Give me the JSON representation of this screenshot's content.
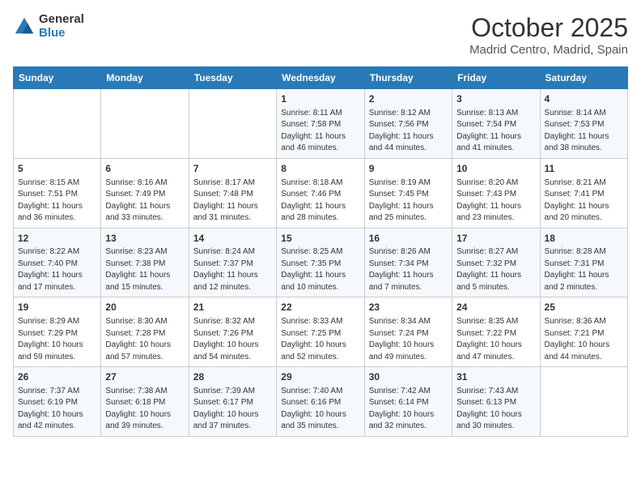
{
  "logo": {
    "line1": "General",
    "line2": "Blue"
  },
  "header": {
    "month": "October 2025",
    "location": "Madrid Centro, Madrid, Spain"
  },
  "days_of_week": [
    "Sunday",
    "Monday",
    "Tuesday",
    "Wednesday",
    "Thursday",
    "Friday",
    "Saturday"
  ],
  "weeks": [
    [
      {
        "day": "",
        "content": ""
      },
      {
        "day": "",
        "content": ""
      },
      {
        "day": "",
        "content": ""
      },
      {
        "day": "1",
        "content": "Sunrise: 8:11 AM\nSunset: 7:58 PM\nDaylight: 11 hours and 46 minutes."
      },
      {
        "day": "2",
        "content": "Sunrise: 8:12 AM\nSunset: 7:56 PM\nDaylight: 11 hours and 44 minutes."
      },
      {
        "day": "3",
        "content": "Sunrise: 8:13 AM\nSunset: 7:54 PM\nDaylight: 11 hours and 41 minutes."
      },
      {
        "day": "4",
        "content": "Sunrise: 8:14 AM\nSunset: 7:53 PM\nDaylight: 11 hours and 38 minutes."
      }
    ],
    [
      {
        "day": "5",
        "content": "Sunrise: 8:15 AM\nSunset: 7:51 PM\nDaylight: 11 hours and 36 minutes."
      },
      {
        "day": "6",
        "content": "Sunrise: 8:16 AM\nSunset: 7:49 PM\nDaylight: 11 hours and 33 minutes."
      },
      {
        "day": "7",
        "content": "Sunrise: 8:17 AM\nSunset: 7:48 PM\nDaylight: 11 hours and 31 minutes."
      },
      {
        "day": "8",
        "content": "Sunrise: 8:18 AM\nSunset: 7:46 PM\nDaylight: 11 hours and 28 minutes."
      },
      {
        "day": "9",
        "content": "Sunrise: 8:19 AM\nSunset: 7:45 PM\nDaylight: 11 hours and 25 minutes."
      },
      {
        "day": "10",
        "content": "Sunrise: 8:20 AM\nSunset: 7:43 PM\nDaylight: 11 hours and 23 minutes."
      },
      {
        "day": "11",
        "content": "Sunrise: 8:21 AM\nSunset: 7:41 PM\nDaylight: 11 hours and 20 minutes."
      }
    ],
    [
      {
        "day": "12",
        "content": "Sunrise: 8:22 AM\nSunset: 7:40 PM\nDaylight: 11 hours and 17 minutes."
      },
      {
        "day": "13",
        "content": "Sunrise: 8:23 AM\nSunset: 7:38 PM\nDaylight: 11 hours and 15 minutes."
      },
      {
        "day": "14",
        "content": "Sunrise: 8:24 AM\nSunset: 7:37 PM\nDaylight: 11 hours and 12 minutes."
      },
      {
        "day": "15",
        "content": "Sunrise: 8:25 AM\nSunset: 7:35 PM\nDaylight: 11 hours and 10 minutes."
      },
      {
        "day": "16",
        "content": "Sunrise: 8:26 AM\nSunset: 7:34 PM\nDaylight: 11 hours and 7 minutes."
      },
      {
        "day": "17",
        "content": "Sunrise: 8:27 AM\nSunset: 7:32 PM\nDaylight: 11 hours and 5 minutes."
      },
      {
        "day": "18",
        "content": "Sunrise: 8:28 AM\nSunset: 7:31 PM\nDaylight: 11 hours and 2 minutes."
      }
    ],
    [
      {
        "day": "19",
        "content": "Sunrise: 8:29 AM\nSunset: 7:29 PM\nDaylight: 10 hours and 59 minutes."
      },
      {
        "day": "20",
        "content": "Sunrise: 8:30 AM\nSunset: 7:28 PM\nDaylight: 10 hours and 57 minutes."
      },
      {
        "day": "21",
        "content": "Sunrise: 8:32 AM\nSunset: 7:26 PM\nDaylight: 10 hours and 54 minutes."
      },
      {
        "day": "22",
        "content": "Sunrise: 8:33 AM\nSunset: 7:25 PM\nDaylight: 10 hours and 52 minutes."
      },
      {
        "day": "23",
        "content": "Sunrise: 8:34 AM\nSunset: 7:24 PM\nDaylight: 10 hours and 49 minutes."
      },
      {
        "day": "24",
        "content": "Sunrise: 8:35 AM\nSunset: 7:22 PM\nDaylight: 10 hours and 47 minutes."
      },
      {
        "day": "25",
        "content": "Sunrise: 8:36 AM\nSunset: 7:21 PM\nDaylight: 10 hours and 44 minutes."
      }
    ],
    [
      {
        "day": "26",
        "content": "Sunrise: 7:37 AM\nSunset: 6:19 PM\nDaylight: 10 hours and 42 minutes."
      },
      {
        "day": "27",
        "content": "Sunrise: 7:38 AM\nSunset: 6:18 PM\nDaylight: 10 hours and 39 minutes."
      },
      {
        "day": "28",
        "content": "Sunrise: 7:39 AM\nSunset: 6:17 PM\nDaylight: 10 hours and 37 minutes."
      },
      {
        "day": "29",
        "content": "Sunrise: 7:40 AM\nSunset: 6:16 PM\nDaylight: 10 hours and 35 minutes."
      },
      {
        "day": "30",
        "content": "Sunrise: 7:42 AM\nSunset: 6:14 PM\nDaylight: 10 hours and 32 minutes."
      },
      {
        "day": "31",
        "content": "Sunrise: 7:43 AM\nSunset: 6:13 PM\nDaylight: 10 hours and 30 minutes."
      },
      {
        "day": "",
        "content": ""
      }
    ]
  ]
}
